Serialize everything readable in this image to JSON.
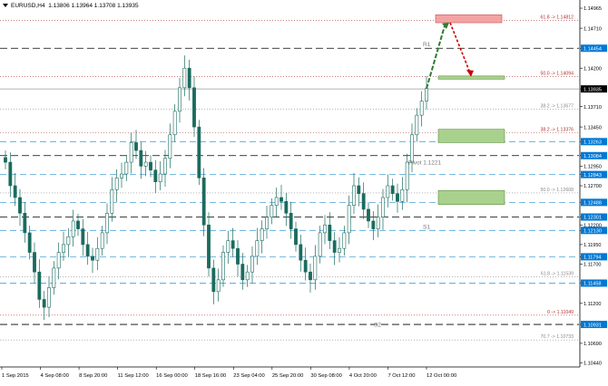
{
  "header": {
    "symbol": "EURUSD,H4",
    "ohlc": "1.13806 1.13964 1.13708 1.13935"
  },
  "chart_data": {
    "type": "candlestick",
    "ylim": [
      1.104,
      1.15
    ],
    "price_ticks": [
      {
        "value": 1.14965,
        "label": "1.14965"
      },
      {
        "value": 1.1471,
        "label": "1.14710"
      },
      {
        "value": 1.14454,
        "label": "1.14454",
        "highlight": true
      },
      {
        "value": 1.142,
        "label": "1.14200"
      },
      {
        "value": 1.13935,
        "label": "1.13935",
        "current": true
      },
      {
        "value": 1.1371,
        "label": "1.13710"
      },
      {
        "value": 1.1345,
        "label": "1.13450"
      },
      {
        "value": 1.13263,
        "label": "1.13263",
        "highlight": true
      },
      {
        "value": 1.13084,
        "label": "1.13084",
        "highlight": true
      },
      {
        "value": 1.1295,
        "label": "1.12950"
      },
      {
        "value": 1.12843,
        "label": "1.12843",
        "highlight": true
      },
      {
        "value": 1.127,
        "label": "1.12700"
      },
      {
        "value": 1.12488,
        "label": "1.12488",
        "highlight": true
      },
      {
        "value": 1.12301,
        "label": "1.12301",
        "highlight": true
      },
      {
        "value": 1.122,
        "label": "1.12200"
      },
      {
        "value": 1.1213,
        "label": "1.12130",
        "highlight": true
      },
      {
        "value": 1.1195,
        "label": "1.11950"
      },
      {
        "value": 1.11794,
        "label": "1.11794",
        "highlight": true
      },
      {
        "value": 1.117,
        "label": "1.11700"
      },
      {
        "value": 1.11458,
        "label": "1.11458",
        "highlight": true
      },
      {
        "value": 1.112,
        "label": "1.11200"
      },
      {
        "value": 1.10931,
        "label": "1.10931",
        "highlight": true
      },
      {
        "value": 1.1069,
        "label": "1.10690"
      },
      {
        "value": 1.1044,
        "label": "1.10440"
      }
    ],
    "time_labels": [
      "1 Sep 2015",
      "4 Sep 08:00",
      "8 Sep 20:00",
      "11 Sep 12:00",
      "16 Sep 00:00",
      "18 Sep 16:00",
      "23 Sep 04:00",
      "25 Sep 20:00",
      "30 Sep 08:00",
      "4 Oct 20:00",
      "7 Oct 12:00",
      "12 Oct 00:00"
    ],
    "levels": [
      {
        "value": 1.14454,
        "style": "black-dash"
      },
      {
        "value": 1.13935,
        "style": "grey-solid"
      },
      {
        "value": 1.13263,
        "style": "blue-dash"
      },
      {
        "value": 1.13084,
        "style": "black-dash"
      },
      {
        "value": 1.12843,
        "style": "blue-dash"
      },
      {
        "value": 1.12488,
        "style": "blue-dash"
      },
      {
        "value": 1.12301,
        "style": "black-dash"
      },
      {
        "value": 1.1213,
        "style": "blue-dash"
      },
      {
        "value": 1.11794,
        "style": "blue-dash"
      },
      {
        "value": 1.11458,
        "style": "blue-dash"
      },
      {
        "value": 1.10931,
        "style": "black-dash"
      }
    ],
    "fib_lines": [
      {
        "value": 1.14812,
        "label": "61.8 -> 1.14812",
        "color": "#b03030"
      },
      {
        "value": 1.14094,
        "label": "50.0 -> 1.14094",
        "color": "#b03030"
      },
      {
        "value": 1.13677,
        "label": "38.2 -> 1.13677",
        "color": "#888888"
      },
      {
        "value": 1.13376,
        "label": "38.2 -> 1.13376",
        "color": "#b03030"
      },
      {
        "value": 1.12608,
        "label": "50.0 -> 1.12608",
        "color": "#888888"
      },
      {
        "value": 1.11539,
        "label": "61.8 -> 1.11539",
        "color": "#888888"
      },
      {
        "value": 1.11049,
        "label": "0 -> 1.11049",
        "color": "#b03030"
      },
      {
        "value": 1.10733,
        "label": "70.7 -> 1.10733",
        "color": "#888888"
      }
    ],
    "pivot_labels": [
      {
        "value": 1.14454,
        "label": "R1"
      },
      {
        "value": 1.1295,
        "label": "Pivot 1.1221"
      },
      {
        "value": 1.1213,
        "label": "S1"
      },
      {
        "value": 1.1088,
        "label": "S2"
      }
    ],
    "zones": [
      {
        "from": 1.1478,
        "to": 1.1488,
        "color": "#f4a3a3",
        "border": "#c05050"
      },
      {
        "from": 1.1406,
        "to": 1.141,
        "color": "#a9d18e",
        "border": "#5a8f3a"
      },
      {
        "from": 1.1325,
        "to": 1.1342,
        "color": "#a9d18e",
        "border": "#5a8f3a"
      },
      {
        "from": 1.1246,
        "to": 1.1264,
        "color": "#a9d18e",
        "border": "#5a8f3a"
      }
    ],
    "close_path": [
      1.13,
      1.127,
      1.1255,
      1.1235,
      1.121,
      1.1185,
      1.116,
      1.1125,
      1.1115,
      1.114,
      1.1165,
      1.1185,
      1.1195,
      1.1205,
      1.1225,
      1.1215,
      1.1195,
      1.118,
      1.1175,
      1.119,
      1.121,
      1.1235,
      1.1265,
      1.128,
      1.1285,
      1.13,
      1.1325,
      1.1315,
      1.1295,
      1.13,
      1.129,
      1.1275,
      1.1285,
      1.1305,
      1.1335,
      1.1365,
      1.1395,
      1.142,
      1.1395,
      1.1345,
      1.128,
      1.122,
      1.1165,
      1.1135,
      1.115,
      1.1185,
      1.12,
      1.119,
      1.117,
      1.115,
      1.116,
      1.118,
      1.12,
      1.1215,
      1.123,
      1.1245,
      1.1255,
      1.125,
      1.1235,
      1.1215,
      1.1195,
      1.1175,
      1.116,
      1.115,
      1.118,
      1.121,
      1.122,
      1.12,
      1.1185,
      1.119,
      1.121,
      1.1245,
      1.127,
      1.126,
      1.124,
      1.1225,
      1.1215,
      1.123,
      1.1255,
      1.127,
      1.126,
      1.125,
      1.1265,
      1.13,
      1.1335,
      1.136,
      1.1378,
      1.1394
    ]
  }
}
